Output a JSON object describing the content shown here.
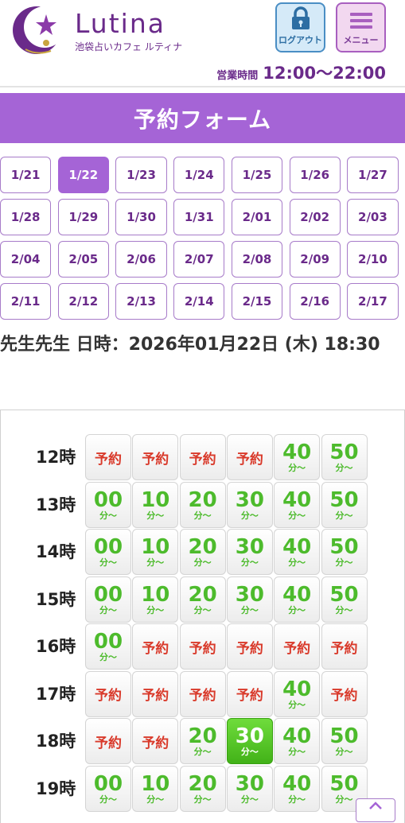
{
  "header": {
    "brand_name": "Lutina",
    "brand_sub": "池袋占いカフェ ルティナ",
    "logout_label": "ログアウト",
    "menu_label": "メニュー",
    "hours_label": "営業時間",
    "hours_value": "12:00〜22:00"
  },
  "page": {
    "title": "予約フォーム"
  },
  "dates": [
    [
      "1/21",
      "1/22",
      "1/23",
      "1/24",
      "1/25",
      "1/26",
      "1/27"
    ],
    [
      "1/28",
      "1/29",
      "1/30",
      "1/31",
      "2/01",
      "2/02",
      "2/03"
    ],
    [
      "2/04",
      "2/05",
      "2/06",
      "2/07",
      "2/08",
      "2/09",
      "2/10"
    ],
    [
      "2/11",
      "2/12",
      "2/13",
      "2/14",
      "2/15",
      "2/16",
      "2/17"
    ]
  ],
  "selected_date": "1/22",
  "selection_text": "先生先生 日時：2026年01月22日 (木) 18:30",
  "slot_suffix": "分〜",
  "reserved_label": "予約",
  "selected_slot": "18:30",
  "schedule": [
    {
      "hour": "12時",
      "slots": [
        "予約",
        "予約",
        "予約",
        "予約",
        "40",
        "50"
      ]
    },
    {
      "hour": "13時",
      "slots": [
        "00",
        "10",
        "20",
        "30",
        "40",
        "50"
      ]
    },
    {
      "hour": "14時",
      "slots": [
        "00",
        "10",
        "20",
        "30",
        "40",
        "50"
      ]
    },
    {
      "hour": "15時",
      "slots": [
        "00",
        "10",
        "20",
        "30",
        "40",
        "50"
      ]
    },
    {
      "hour": "16時",
      "slots": [
        "00",
        "予約",
        "予約",
        "予約",
        "予約",
        "予約"
      ]
    },
    {
      "hour": "17時",
      "slots": [
        "予約",
        "予約",
        "予約",
        "予約",
        "40",
        "予約"
      ]
    },
    {
      "hour": "18時",
      "slots": [
        "予約",
        "予約",
        "20",
        "30",
        "40",
        "50"
      ]
    },
    {
      "hour": "19時",
      "slots": [
        "00",
        "10",
        "20",
        "30",
        "40",
        "50"
      ]
    }
  ],
  "colors": {
    "brand_purple": "#a564d6",
    "available_green": "#4dbb2c",
    "reserved_red": "#d93a2b",
    "selected_green": "#42b218"
  },
  "icons": {
    "logout": "padlock-icon",
    "menu": "hamburger-icon",
    "scroll_top": "chevron-up-icon",
    "logo": "crescent-moon-star-logo"
  }
}
